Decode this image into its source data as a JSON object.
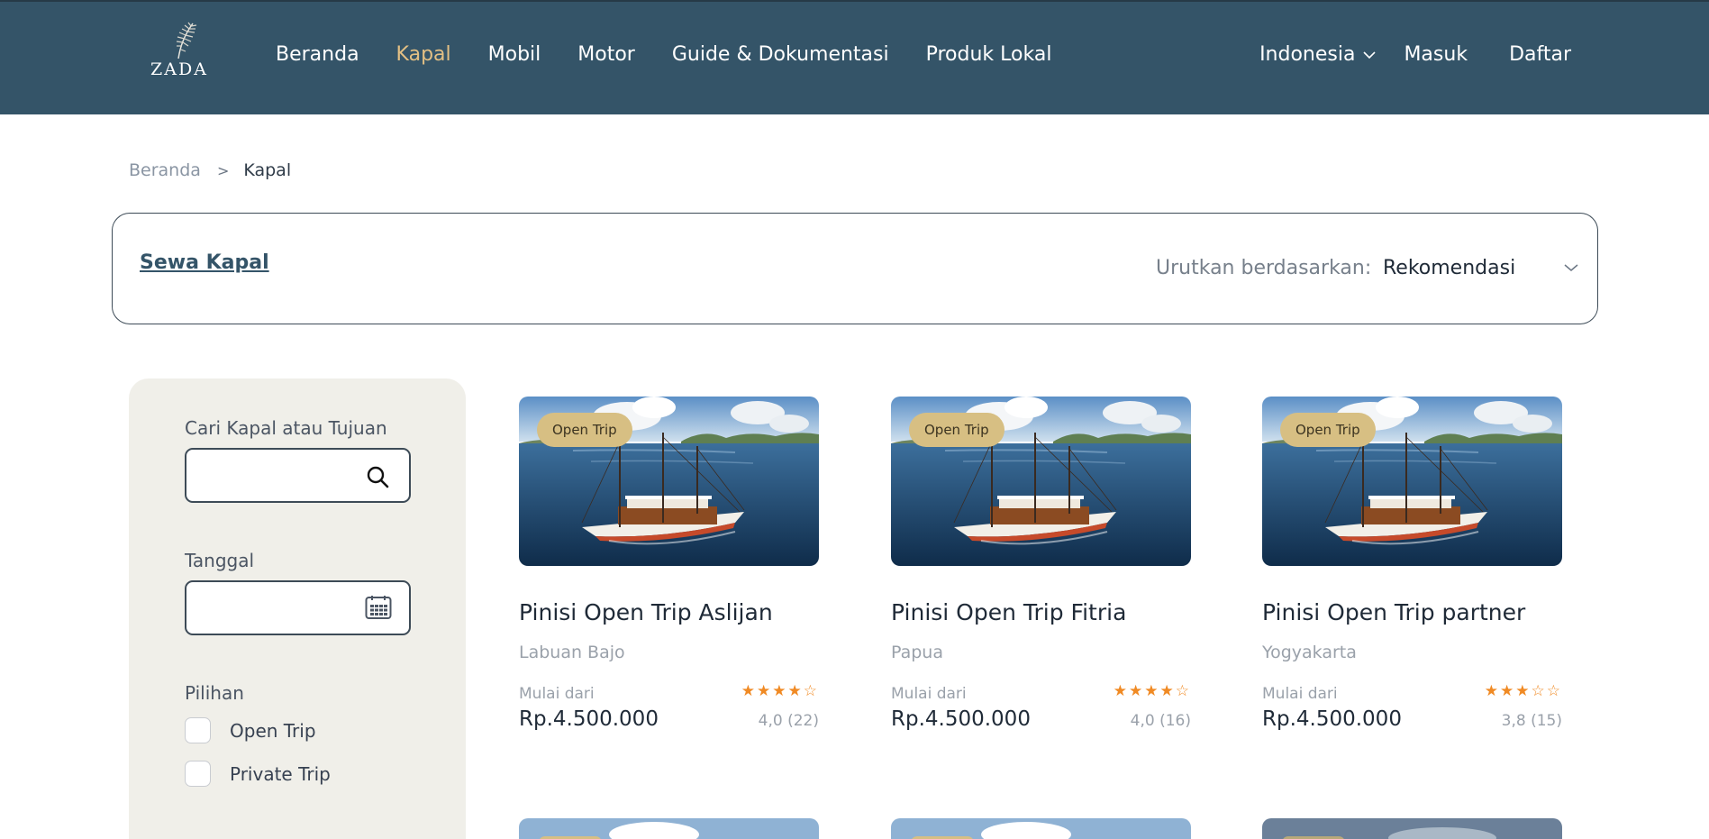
{
  "header": {
    "logo_text": "ZADA",
    "nav": [
      {
        "label": "Beranda",
        "active": false
      },
      {
        "label": "Kapal",
        "active": true
      },
      {
        "label": "Mobil",
        "active": false
      },
      {
        "label": "Motor",
        "active": false
      },
      {
        "label": "Guide & Dokumentasi",
        "active": false
      },
      {
        "label": "Produk Lokal",
        "active": false
      }
    ],
    "language": "Indonesia",
    "login": "Masuk",
    "register": "Daftar"
  },
  "breadcrumb": {
    "home": "Beranda",
    "separator": ">",
    "current": "Kapal"
  },
  "filterbar": {
    "title": "Sewa Kapal",
    "sort_label": "Urutkan berdasarkan:",
    "sort_value": "Rekomendasi"
  },
  "sidebar": {
    "search_label": "Cari Kapal atau Tujuan",
    "search_value": "",
    "date_label": "Tanggal",
    "date_value": "",
    "options_label": "Pilihan",
    "options": [
      {
        "label": "Open Trip",
        "checked": false
      },
      {
        "label": "Private Trip",
        "checked": false
      }
    ]
  },
  "cards": [
    {
      "badge": "Open Trip",
      "title": "Pinisi Open Trip Aslijan",
      "location": "Labuan Bajo",
      "from_label": "Mulai dari",
      "price": "Rp.4.500.000",
      "stars": 4,
      "rating": "4,0 (22)"
    },
    {
      "badge": "Open Trip",
      "title": "Pinisi Open Trip Fitria",
      "location": "Papua",
      "from_label": "Mulai dari",
      "price": "Rp.4.500.000",
      "stars": 4,
      "rating": "4,0 (16)"
    },
    {
      "badge": "Open Trip",
      "title": "Pinisi Open Trip partner",
      "location": "Yogyakarta",
      "from_label": "Mulai dari",
      "price": "Rp.4.500.000",
      "stars": 3,
      "rating": "3,8 (15)"
    }
  ],
  "colors": {
    "header_bg": "#345468",
    "nav_active": "#e3c084",
    "badge_bg": "#d7bf83",
    "star": "#f08a24",
    "sidebar_bg": "#f0efe9"
  }
}
